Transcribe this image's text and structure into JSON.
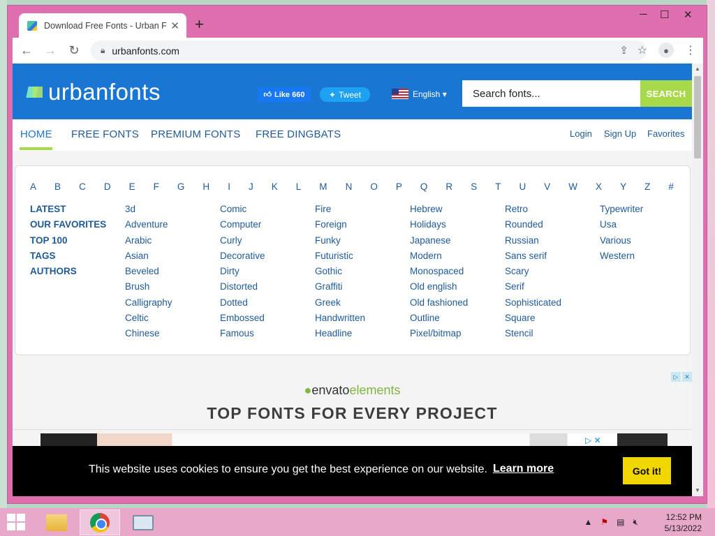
{
  "browser": {
    "tab_title": "Download Free Fonts - Urban Fon",
    "url": "urbanfonts.com",
    "new_tab_symbol": "+",
    "minimize": "─",
    "maximize": "☐",
    "close": "✕"
  },
  "site": {
    "logo_text": "urbanfonts",
    "like_label": "Like 660",
    "tweet_label": "Tweet",
    "language": "English ▾",
    "search_placeholder": "Search fonts...",
    "search_button": "SEARCH"
  },
  "nav": {
    "items": [
      "HOME",
      "FREE FONTS",
      "PREMIUM FONTS",
      "FREE DINGBATS"
    ],
    "right": [
      "Login",
      "Sign Up",
      "Favorites"
    ]
  },
  "alphabet": [
    "A",
    "B",
    "C",
    "D",
    "E",
    "F",
    "G",
    "H",
    "I",
    "J",
    "K",
    "L",
    "M",
    "N",
    "O",
    "P",
    "Q",
    "R",
    "S",
    "T",
    "U",
    "V",
    "W",
    "X",
    "Y",
    "Z",
    "#"
  ],
  "columns": [
    [
      "LATEST",
      "OUR FAVORITES",
      "TOP 100",
      "TAGS",
      "AUTHORS"
    ],
    [
      "3d",
      "Adventure",
      "Arabic",
      "Asian",
      "Beveled",
      "Brush",
      "Calligraphy",
      "Celtic",
      "Chinese"
    ],
    [
      "Comic",
      "Computer",
      "Curly",
      "Decorative",
      "Dirty",
      "Distorted",
      "Dotted",
      "Embossed",
      "Famous"
    ],
    [
      "Fire",
      "Foreign",
      "Funky",
      "Futuristic",
      "Gothic",
      "Graffiti",
      "Greek",
      "Handwritten",
      "Headline"
    ],
    [
      "Hebrew",
      "Holidays",
      "Japanese",
      "Modern",
      "Monospaced",
      "Old english",
      "Old fashioned",
      "Outline",
      "Pixel/bitmap"
    ],
    [
      "Retro",
      "Rounded",
      "Russian",
      "Sans serif",
      "Scary",
      "Serif",
      "Sophisticated",
      "Square",
      "Stencil"
    ],
    [
      "Typewriter",
      "Usa",
      "Various",
      "Western"
    ]
  ],
  "ad": {
    "brand_prefix": "envato",
    "brand_suffix": "elements",
    "headline": "TOP FONTS FOR EVERY PROJECT"
  },
  "cookie": {
    "message": "This website uses cookies to ensure you get the best experience on our website.",
    "learn_more": "Learn more",
    "accept": "Got it!"
  },
  "taskbar": {
    "time": "12:52 PM",
    "date": "5/13/2022"
  },
  "colors": {
    "header_blue": "#1976d2",
    "accent_green": "#a8d94b",
    "window_frame": "#e06fb0",
    "link": "#1f5a96"
  }
}
